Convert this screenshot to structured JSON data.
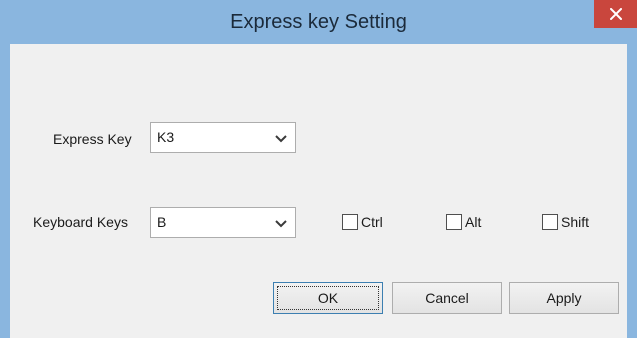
{
  "window": {
    "title": "Express key Setting",
    "close_icon": "close-x-icon"
  },
  "form": {
    "express_key": {
      "label": "Express Key",
      "value": "K3",
      "icon": "chevron-down-icon"
    },
    "keyboard_keys": {
      "label": "Keyboard Keys",
      "value": "B",
      "icon": "chevron-down-icon"
    },
    "modifiers": [
      {
        "label": "Ctrl",
        "checked": false
      },
      {
        "label": "Alt",
        "checked": false
      },
      {
        "label": "Shift",
        "checked": false
      }
    ]
  },
  "buttons": {
    "ok": "OK",
    "cancel": "Cancel",
    "apply": "Apply"
  },
  "colors": {
    "title_bar": "#8ab6df",
    "close_button": "#c9463d",
    "client_background": "#f0f0f0"
  }
}
